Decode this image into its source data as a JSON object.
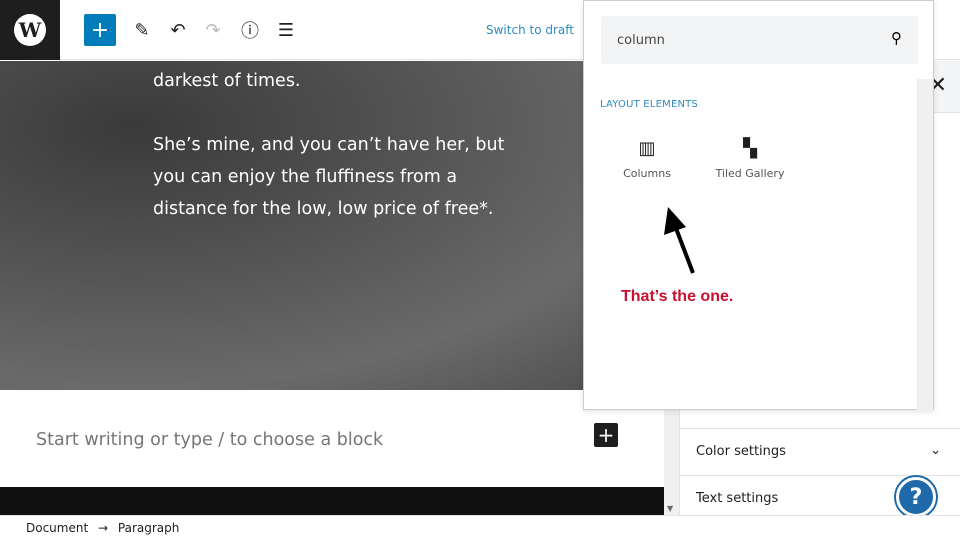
{
  "toolbar": {
    "logo": "W",
    "add": "+",
    "tools": "✎",
    "undo": "↶",
    "redo": "↷",
    "info": "ⓘ",
    "outline": "☰",
    "switch_to_draft": "Switch to draft"
  },
  "cover": {
    "line1": "darkest of times.",
    "para2": "She’s mine, and you can’t have her, but you can enjoy the fluffiness from a distance for the low, low price of free*."
  },
  "editor": {
    "placeholder": "Start writing or type / to choose a block",
    "add": "+"
  },
  "inserter": {
    "search_value": "column",
    "category": "LAYOUT ELEMENTS",
    "blocks": [
      {
        "label": "Columns",
        "icon": "columns-icon"
      },
      {
        "label": "Tiled Gallery",
        "icon": "tiled-gallery-icon"
      }
    ]
  },
  "annotation": {
    "text": "That’s the one.",
    "color": "#c8102e"
  },
  "sidebar": {
    "close": "✕",
    "panels": [
      {
        "label": "Color settings"
      },
      {
        "label": "Text settings"
      }
    ]
  },
  "help": "?",
  "footer": {
    "document": "Document",
    "arrow": "→",
    "paragraph": "Paragraph"
  },
  "colors": {
    "accent": "#007cba",
    "link": "#2e8bc0"
  }
}
